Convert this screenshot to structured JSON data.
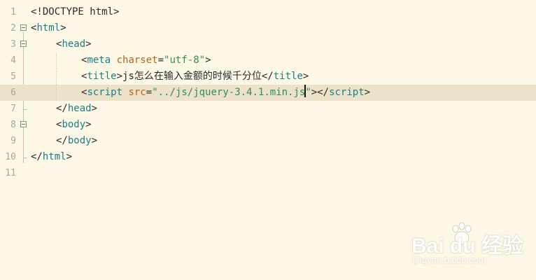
{
  "editor": {
    "lines": [
      {
        "number": "1",
        "parts": [
          {
            "c": "b",
            "t": "<!DOCTYPE html>"
          }
        ]
      },
      {
        "number": "2",
        "parts": [
          {
            "c": "b",
            "t": "<"
          },
          {
            "c": "tg",
            "t": "html"
          },
          {
            "c": "b",
            "t": ">"
          }
        ]
      },
      {
        "number": "3",
        "parts": [
          {
            "c": "b",
            "t": "<"
          },
          {
            "c": "tg",
            "t": "head"
          },
          {
            "c": "b",
            "t": ">"
          }
        ]
      },
      {
        "number": "4",
        "parts": [
          {
            "c": "b",
            "t": "<"
          },
          {
            "c": "tg",
            "t": "meta"
          },
          {
            "c": "b",
            "t": " "
          },
          {
            "c": "at",
            "t": "charset"
          },
          {
            "c": "b",
            "t": "="
          },
          {
            "c": "st",
            "t": "\"utf-8\""
          },
          {
            "c": "b",
            "t": ">"
          }
        ]
      },
      {
        "number": "5",
        "parts": [
          {
            "c": "b",
            "t": "<"
          },
          {
            "c": "tg",
            "t": "title"
          },
          {
            "c": "b",
            "t": ">js怎么在输入金额的时候千分位</"
          },
          {
            "c": "tg",
            "t": "title"
          },
          {
            "c": "b",
            "t": ">"
          }
        ]
      },
      {
        "number": "6",
        "parts": [
          {
            "c": "b",
            "t": "<"
          },
          {
            "c": "tg",
            "t": "script"
          },
          {
            "c": "b",
            "t": " "
          },
          {
            "c": "at",
            "t": "src"
          },
          {
            "c": "b",
            "t": "="
          },
          {
            "c": "st",
            "t": "\"../js/jquery-3.4.1.min.js"
          },
          {
            "c": "cur",
            "t": ""
          },
          {
            "c": "st",
            "t": "\""
          },
          {
            "c": "b",
            "t": "></"
          },
          {
            "c": "tg",
            "t": "script"
          },
          {
            "c": "b",
            "t": ">"
          }
        ]
      },
      {
        "number": "7",
        "parts": [
          {
            "c": "b",
            "t": "</"
          },
          {
            "c": "tg",
            "t": "head"
          },
          {
            "c": "b",
            "t": ">"
          }
        ]
      },
      {
        "number": "8",
        "parts": [
          {
            "c": "b",
            "t": "<"
          },
          {
            "c": "tg",
            "t": "body"
          },
          {
            "c": "b",
            "t": ">"
          }
        ]
      },
      {
        "number": "9",
        "parts": [
          {
            "c": "b",
            "t": "</"
          },
          {
            "c": "tg",
            "t": "body"
          },
          {
            "c": "b",
            "t": ">"
          }
        ]
      },
      {
        "number": "10",
        "parts": [
          {
            "c": "b",
            "t": "</"
          },
          {
            "c": "tg",
            "t": "html"
          },
          {
            "c": "b",
            "t": ">"
          }
        ]
      },
      {
        "number": "11",
        "parts": []
      }
    ]
  },
  "watermark": {
    "brand": "Bai du 经验",
    "url": "jingyan.baidu.com"
  },
  "colors": {
    "background": "#fdf7e6",
    "current_line": "#ebe2c9",
    "tag": "#1a7f8a",
    "attribute": "#b5651d",
    "string": "#2f8f57"
  }
}
